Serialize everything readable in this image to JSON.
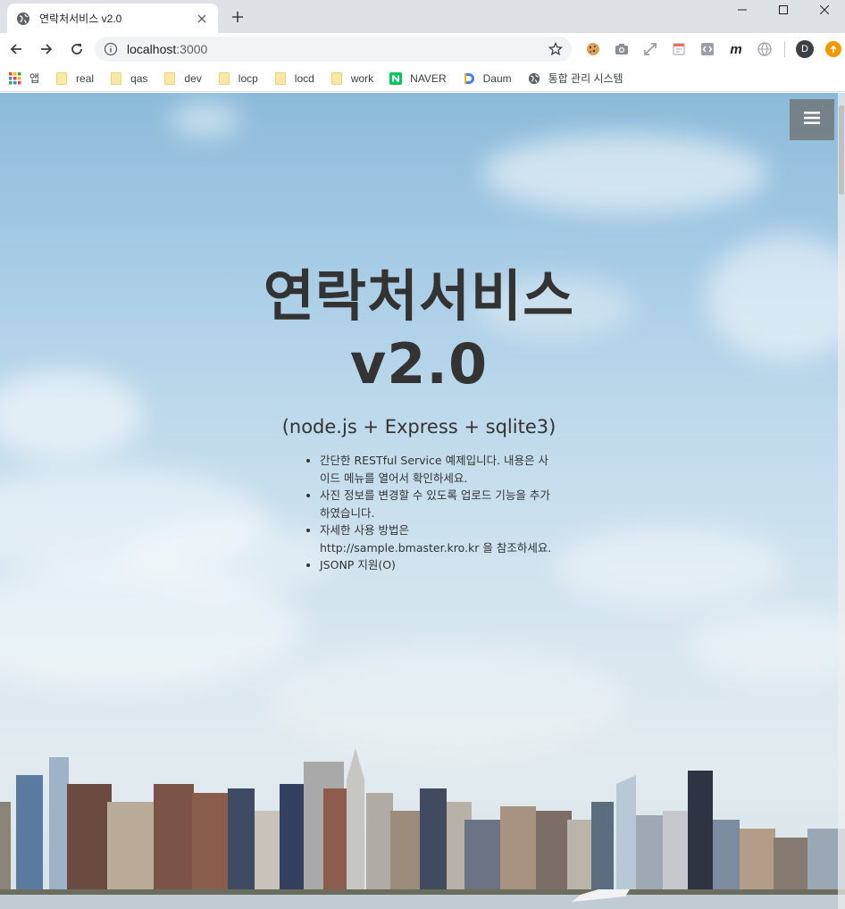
{
  "tab": {
    "title": "연락처서비스 v2.0",
    "favicon": "globe-icon"
  },
  "omnibox": {
    "host": "localhost",
    "port": ":3000"
  },
  "bookmarks": [
    {
      "label": "앱",
      "icon": "apps-grid-icon"
    },
    {
      "label": "real",
      "icon": "folder-icon"
    },
    {
      "label": "qas",
      "icon": "folder-icon"
    },
    {
      "label": "dev",
      "icon": "folder-icon"
    },
    {
      "label": "locp",
      "icon": "folder-icon"
    },
    {
      "label": "locd",
      "icon": "folder-icon"
    },
    {
      "label": "work",
      "icon": "folder-icon"
    },
    {
      "label": "NAVER",
      "icon": "naver-icon"
    },
    {
      "label": "Daum",
      "icon": "daum-icon"
    },
    {
      "label": "통합 관리 시스템",
      "icon": "globe-icon"
    }
  ],
  "profile": {
    "initial": "D"
  },
  "hero": {
    "title_line1": "연락처서비스",
    "title_line2": "v2.0",
    "subtitle": "(node.js + Express + sqlite3)",
    "items": [
      "간단한 RESTful Service 예제입니다. 내용은 사이드 메뉴를 열어서 확인하세요.",
      "사진 정보를 변경할 수 있도록 업로드 기능을 추가하였습니다.",
      "자세한 사용 방법은 http://sample.bmaster.kro.kr 을 참조하세요.",
      "JSONP 지원(O)"
    ]
  },
  "colors": {
    "heading": "#333333",
    "menu_button": "#6e6e6e",
    "tabstrip": "#dee1e6"
  }
}
